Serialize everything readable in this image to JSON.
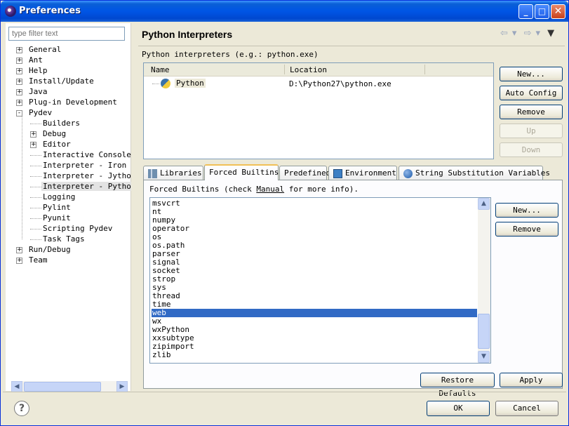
{
  "window": {
    "title": "Preferences",
    "controls": {
      "minimize": "_",
      "maximize": "□",
      "close": "✕"
    }
  },
  "filter": {
    "placeholder": "type filter text"
  },
  "tree": [
    {
      "label": "General",
      "level": 0,
      "expander": "+"
    },
    {
      "label": "Ant",
      "level": 0,
      "expander": "+"
    },
    {
      "label": "Help",
      "level": 0,
      "expander": "+"
    },
    {
      "label": "Install/Update",
      "level": 0,
      "expander": "+"
    },
    {
      "label": "Java",
      "level": 0,
      "expander": "+"
    },
    {
      "label": "Plug-in Development",
      "level": 0,
      "expander": "+"
    },
    {
      "label": "Pydev",
      "level": 0,
      "expander": "-"
    },
    {
      "label": "Builders",
      "level": 1,
      "expander": ""
    },
    {
      "label": "Debug",
      "level": 1,
      "expander": "+"
    },
    {
      "label": "Editor",
      "level": 1,
      "expander": "+"
    },
    {
      "label": "Interactive Console",
      "level": 1,
      "expander": ""
    },
    {
      "label": "Interpreter - Iron Py",
      "level": 1,
      "expander": ""
    },
    {
      "label": "Interpreter - Jython",
      "level": 1,
      "expander": ""
    },
    {
      "label": "Interpreter - Python",
      "level": 1,
      "expander": "",
      "selected": true
    },
    {
      "label": "Logging",
      "level": 1,
      "expander": ""
    },
    {
      "label": "Pylint",
      "level": 1,
      "expander": ""
    },
    {
      "label": "Pyunit",
      "level": 1,
      "expander": ""
    },
    {
      "label": "Scripting Pydev",
      "level": 1,
      "expander": ""
    },
    {
      "label": "Task Tags",
      "level": 1,
      "expander": ""
    },
    {
      "label": "Run/Debug",
      "level": 0,
      "expander": "+"
    },
    {
      "label": "Team",
      "level": 0,
      "expander": "+"
    }
  ],
  "page": {
    "title": "Python Interpreters",
    "nav": {
      "back": "⇦",
      "forward": "⇨",
      "menu": "▼",
      "dropdown": "▾"
    },
    "interpreters_label": "Python interpreters (e.g.: python.exe)",
    "table": {
      "columns": [
        "Name",
        "Location"
      ],
      "rows": [
        {
          "name": "Python",
          "location": "D:\\Python27\\python.exe"
        }
      ]
    },
    "buttons": {
      "new": "New...",
      "auto_config": "Auto Config",
      "remove": "Remove",
      "up": "Up",
      "down": "Down"
    },
    "tabs": [
      "Libraries",
      "Forced Builtins",
      "Predefined",
      "Environment",
      "String Substitution Variables"
    ],
    "active_tab": "Forced Builtins",
    "forced_builtins": {
      "label_before": "Forced Builtins (check ",
      "label_link": "Manual",
      "label_after": " for more info).",
      "items": [
        "msvcrt",
        "nt",
        "numpy",
        "operator",
        "os",
        "os.path",
        "parser",
        "signal",
        "socket",
        "strop",
        "sys",
        "thread",
        "time",
        "web",
        "wx",
        "wxPython",
        "xxsubtype",
        "zipimport",
        "zlib"
      ],
      "selected": "web",
      "new_button": "New...",
      "remove_button": "Remove"
    },
    "restore_defaults": "Restore Defaults",
    "apply": "Apply"
  },
  "footer": {
    "help": "?",
    "ok": "OK",
    "cancel": "Cancel"
  },
  "scroll": {
    "left": "◀",
    "right": "▶",
    "up": "▲",
    "down": "▼"
  }
}
